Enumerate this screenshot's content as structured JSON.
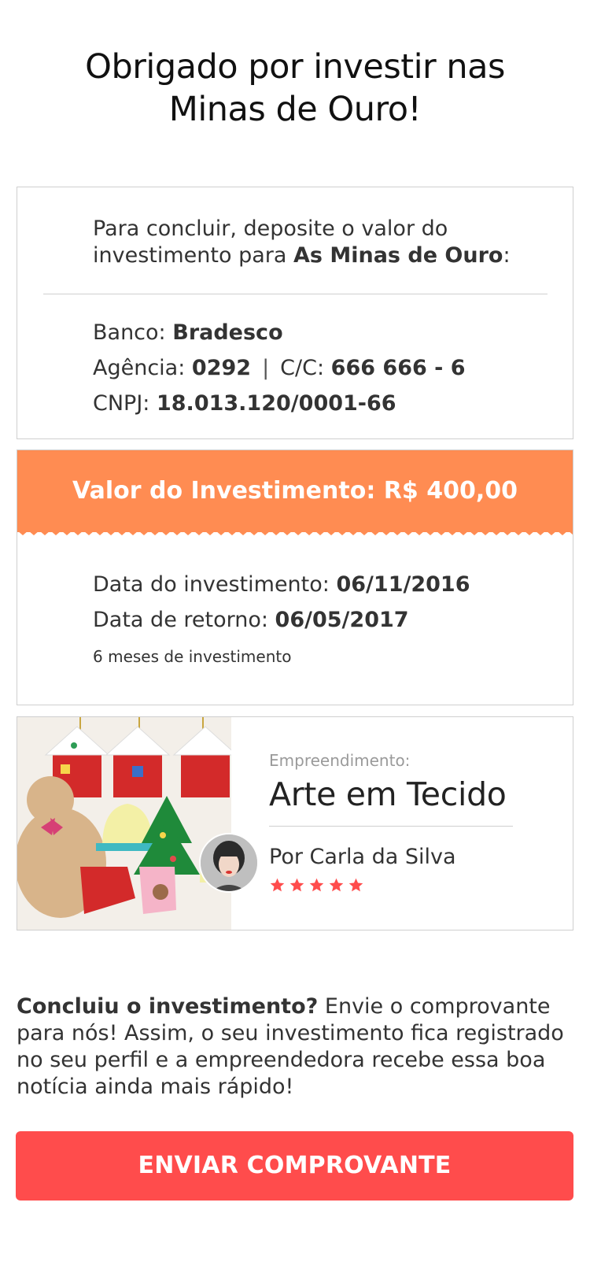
{
  "page": {
    "title_line1": "Obrigado por investir nas",
    "title_line2": "Minas de Ouro!"
  },
  "bank": {
    "intro_text": "Para concluir, deposite o valor do investimento para ",
    "recipient": "As Minas de Ouro",
    "intro_suffix": ":",
    "bank_label": "Banco: ",
    "bank_value": "Bradesco",
    "agency_label": "Agência: ",
    "agency_value": "0292",
    "separator": "|",
    "account_label": "C/C: ",
    "account_value": "666 666 - 6",
    "cnpj_label": "CNPJ: ",
    "cnpj_value": "18.013.120/0001-66"
  },
  "investment": {
    "header": "Valor do Investimento: R$ 400,00",
    "date_label": "Data do investimento: ",
    "date_value": "06/11/2016",
    "return_label": "Data de retorno: ",
    "return_value": "06/05/2017",
    "duration_note": "6 meses de investimento"
  },
  "project": {
    "label": "Empreendimento:",
    "title": "Arte em Tecido",
    "author": "Por Carla da Silva",
    "rating_stars": 5,
    "photo_icon": "felt-christmas-ornaments-photo",
    "avatar_icon": "user-avatar-photo"
  },
  "footer": {
    "lead_bold": "Concluiu o investimento?",
    "body": " Envie o comprovante para nós! Assim, o seu investimento fica registrado no seu perfil e a empreendedora recebe essa boa notícia ainda mais rápido!"
  },
  "cta": {
    "label": "ENVIAR COMPROVANTE"
  },
  "colors": {
    "orange_header": "#ff8c52",
    "cta_red": "#ff4c4c",
    "star_red": "#ff4c4c"
  }
}
